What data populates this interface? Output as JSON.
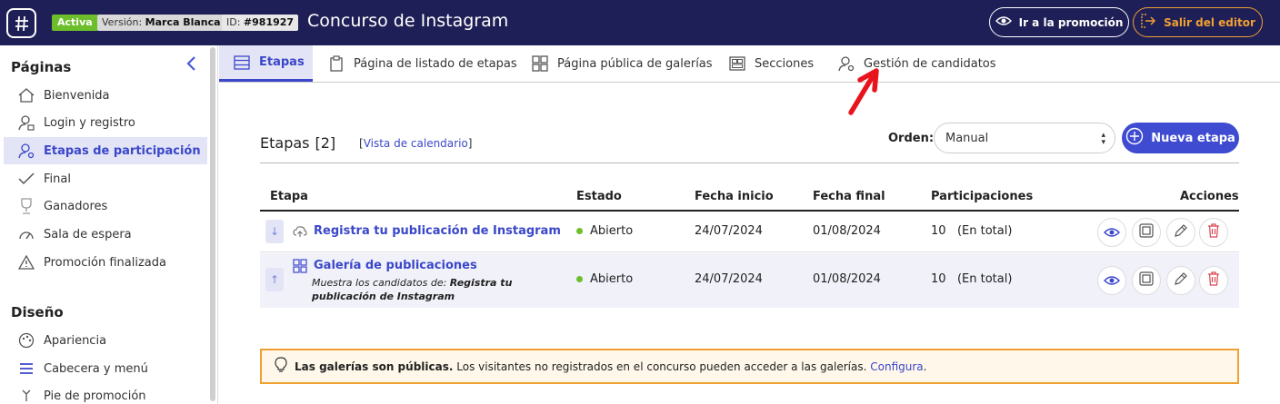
{
  "header": {
    "status_badge": "Activa",
    "version_label": "Versión:",
    "version_value": "Marca Blanca",
    "id_label": "ID:",
    "id_value": "#981927",
    "title": "Concurso de Instagram",
    "promo_button": "Ir a la promoción",
    "exit_button": "Salir del editor",
    "accent_color": "#1f1f57",
    "exit_color": "#f0a032"
  },
  "sidebar": {
    "pages_heading": "Páginas",
    "pages": [
      {
        "label": "Bienvenida",
        "icon": "home-icon"
      },
      {
        "label": "Login y registro",
        "icon": "user-lock-icon"
      },
      {
        "label": "Etapas de participación",
        "icon": "user-gear-icon",
        "active": true
      },
      {
        "label": "Final",
        "icon": "check-icon"
      },
      {
        "label": "Ganadores",
        "icon": "trophy-icon"
      },
      {
        "label": "Sala de espera",
        "icon": "gauge-icon"
      },
      {
        "label": "Promoción finalizada",
        "icon": "warning-icon"
      }
    ],
    "design_heading": "Diseño",
    "design": [
      {
        "label": "Apariencia",
        "icon": "palette-icon"
      },
      {
        "label": "Cabecera y menú",
        "icon": "menu-icon"
      },
      {
        "label": "Pie de promoción",
        "icon": "footer-icon"
      }
    ]
  },
  "tabs": [
    {
      "label": "Etapas",
      "icon": "list-icon",
      "active": true
    },
    {
      "label": "Página de listado de etapas",
      "icon": "clipboard-icon"
    },
    {
      "label": "Página pública de galerías",
      "icon": "grid-icon"
    },
    {
      "label": "Secciones",
      "icon": "sections-icon"
    },
    {
      "label": "Gestión de candidatos",
      "icon": "user-gear-icon"
    }
  ],
  "stages": {
    "title": "Etapas",
    "count": "[2]",
    "calendar_link": "Vista de calendario",
    "order_label": "Orden:",
    "order_value": "Manual",
    "new_button": "Nueva etapa",
    "columns": [
      "Etapa",
      "Estado",
      "Fecha inicio",
      "Fecha final",
      "Participaciones",
      "Acciones"
    ],
    "rows": [
      {
        "name": "Registra tu publicación de Instagram",
        "icon": "cloud-upload-icon",
        "move": "↓",
        "status": "Abierto",
        "start": "24/07/2024",
        "end": "01/08/2024",
        "participations": "10",
        "participations_note": "(En total)"
      },
      {
        "name": "Galería de publicaciones",
        "icon": "grid-icon",
        "move": "↑",
        "sub_prefix": "Muestra los candidatos de:",
        "sub_target": "Registra tu publicación de Instagram",
        "status": "Abierto",
        "start": "24/07/2024",
        "end": "01/08/2024",
        "participations": "10",
        "participations_note": "(En total)"
      }
    ]
  },
  "banner": {
    "bold": "Las galerías son públicas.",
    "text": "Los visitantes no registrados en el concurso pueden acceder a las galerías.",
    "link": "Configura",
    "end": "."
  }
}
